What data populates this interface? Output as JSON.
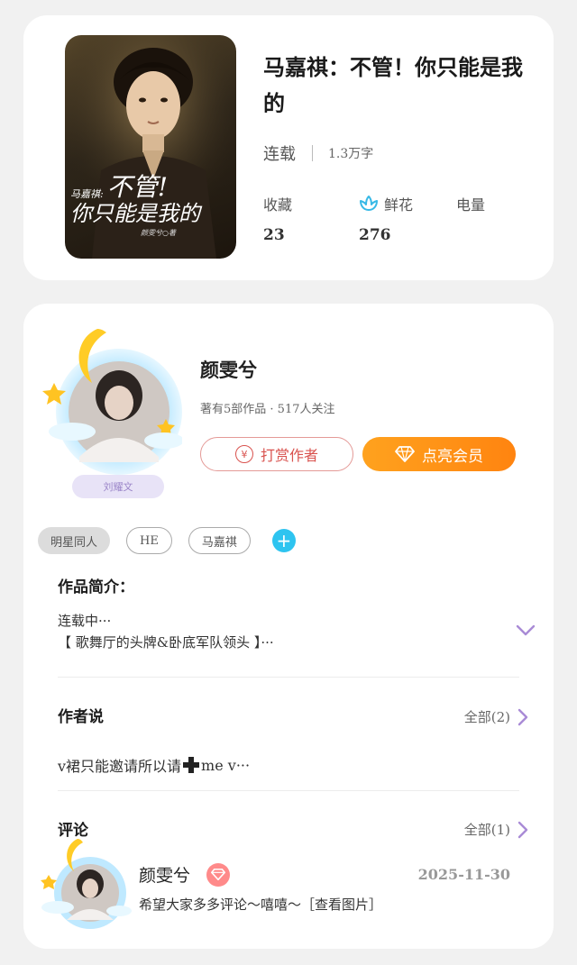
{
  "book": {
    "title": "马嘉祺：不管！你只能是我的",
    "status": "连载",
    "word_count": "1.3万字",
    "cover_text": {
      "prefix": "马嘉祺:",
      "line1": "不管!",
      "line2": "你只能是我的",
      "author": "颜雯兮○著"
    },
    "stats": [
      {
        "label": "收藏",
        "value": "23",
        "icon": ""
      },
      {
        "label": "鲜花",
        "value": "276",
        "icon": "flower-icon"
      },
      {
        "label": "电量",
        "value": "",
        "icon": ""
      }
    ]
  },
  "author": {
    "name": "颜雯兮",
    "meta": "著有5部作品 · 517人关注",
    "badge_name": "刘耀文",
    "tip_button": "打赏作者",
    "vip_button": "点亮会员"
  },
  "tags": [
    "明星同人",
    "HE",
    "马嘉祺"
  ],
  "intro": {
    "heading": "作品简介：",
    "line1": "连载中···",
    "line2": "【 歌舞厅的头牌&卧底军队领头 】···"
  },
  "author_says": {
    "heading": "作者说",
    "more": "全部(2)",
    "text_before": "v裙只能邀请所以请",
    "text_after": "me v···"
  },
  "comments": {
    "heading": "评论",
    "more": "全部(1)",
    "items": [
      {
        "name": "颜雯兮",
        "date": "2025-11-30",
        "text": "希望大家多多评论～嘻嘻～［查看图片］"
      }
    ]
  },
  "colors": {
    "accent_orange": "#ff8c14",
    "tip_red": "#d9534f",
    "tag_blue": "#2ec4f0",
    "chevron_purple": "#a98bd6"
  }
}
